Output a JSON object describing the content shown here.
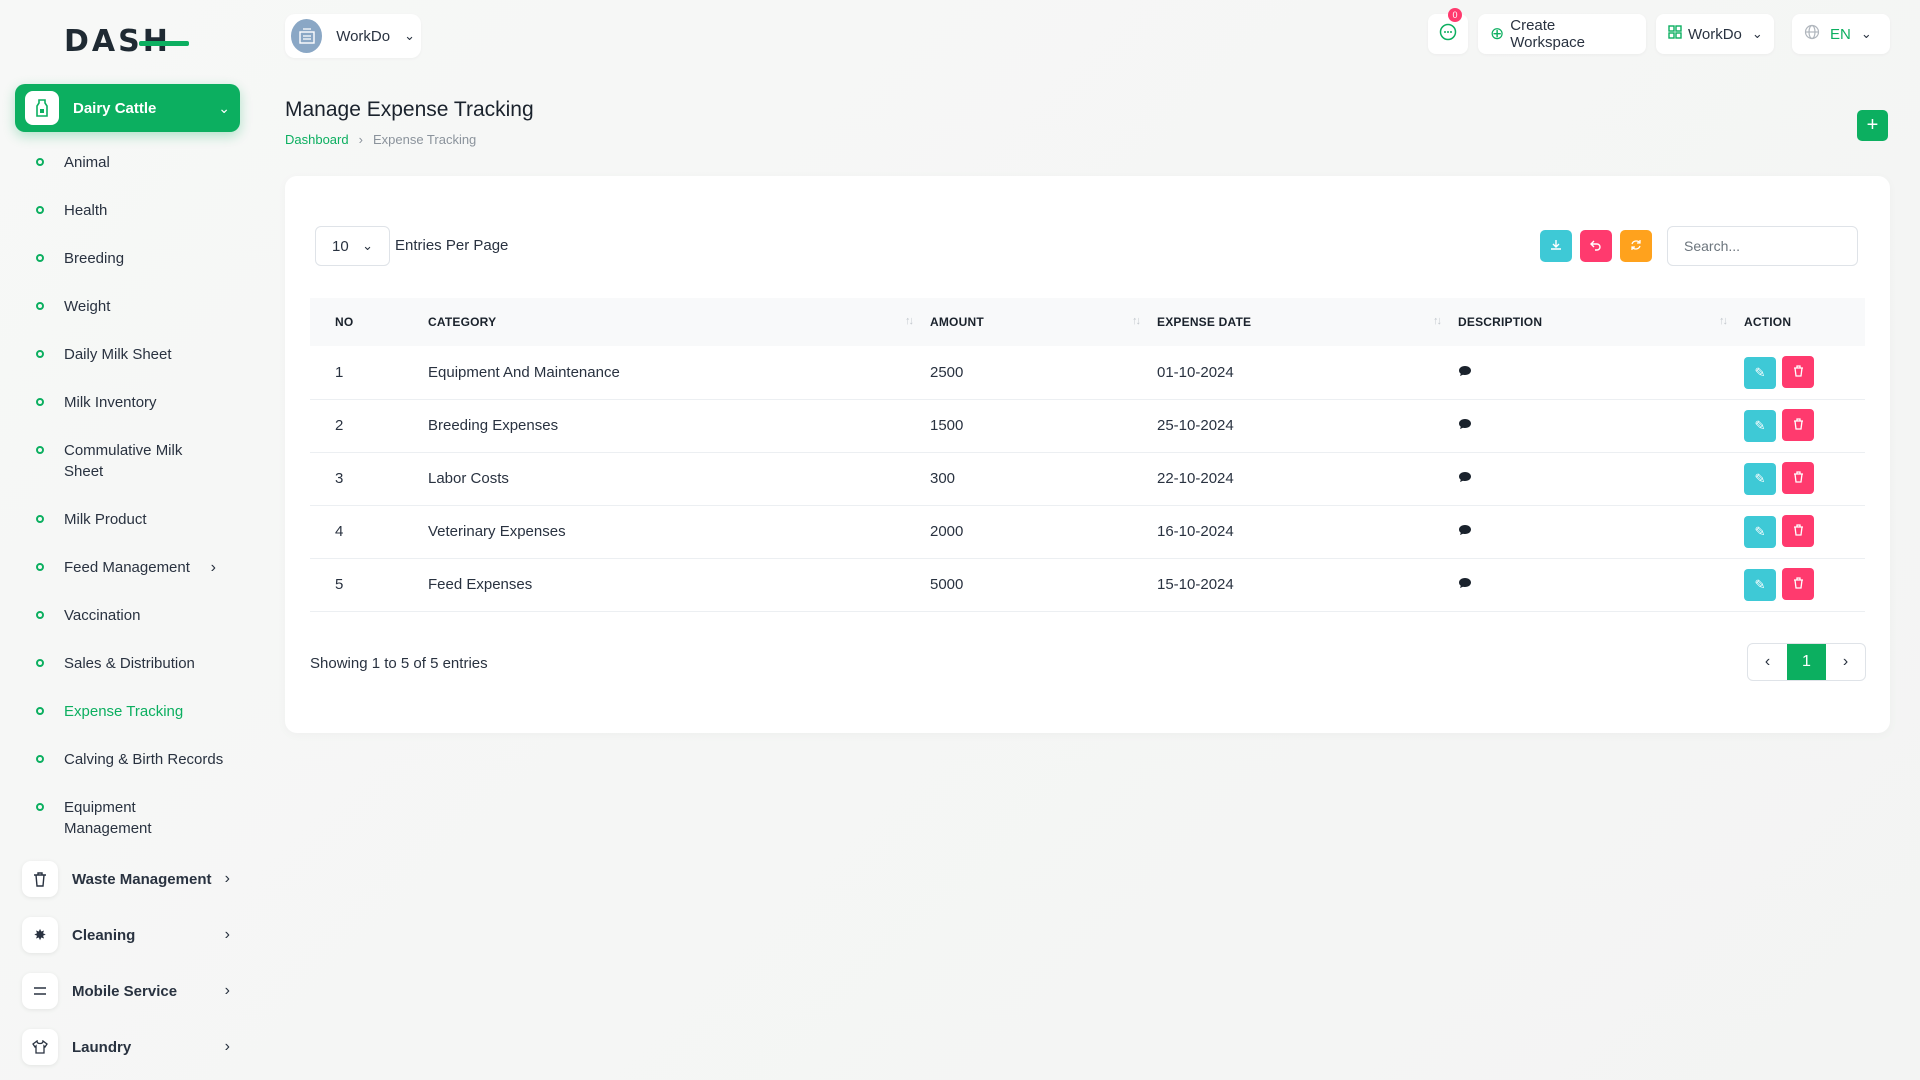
{
  "brand": {
    "logo_text": "DASH"
  },
  "sidebar": {
    "active_module": "Dairy Cattle",
    "items": [
      {
        "label": "Animal"
      },
      {
        "label": "Health"
      },
      {
        "label": "Breeding"
      },
      {
        "label": "Weight"
      },
      {
        "label": "Daily Milk Sheet"
      },
      {
        "label": "Milk Inventory"
      },
      {
        "label": "Commulative Milk Sheet"
      },
      {
        "label": "Milk Product"
      },
      {
        "label": "Feed Management"
      },
      {
        "label": "Vaccination"
      },
      {
        "label": "Sales & Distribution"
      },
      {
        "label": "Expense Tracking"
      },
      {
        "label": "Calving & Birth Records"
      },
      {
        "label": "Equipment Management"
      }
    ],
    "modules": [
      {
        "label": "Waste Management",
        "icon": "trash-icon"
      },
      {
        "label": "Cleaning",
        "icon": "sparkle-icon"
      },
      {
        "label": "Mobile Service",
        "icon": "menu-lines-icon"
      },
      {
        "label": "Laundry",
        "icon": "shirt-icon"
      }
    ]
  },
  "header": {
    "workspace_name": "WorkDo",
    "notification_count": "0",
    "create_workspace_label": "Create Workspace",
    "workspace_menu_label": "WorkDo",
    "language": "EN"
  },
  "page": {
    "title": "Manage Expense Tracking",
    "breadcrumb": [
      "Dashboard",
      "Expense Tracking"
    ]
  },
  "table_controls": {
    "per_page_value": "10",
    "per_page_label": "Entries Per Page",
    "search_placeholder": "Search..."
  },
  "table": {
    "columns": [
      "NO",
      "CATEGORY",
      "AMOUNT",
      "EXPENSE DATE",
      "DESCRIPTION",
      "ACTION"
    ],
    "rows": [
      {
        "no": "1",
        "category": "Equipment And Maintenance",
        "amount": "2500",
        "date": "01-10-2024"
      },
      {
        "no": "2",
        "category": "Breeding Expenses",
        "amount": "1500",
        "date": "25-10-2024"
      },
      {
        "no": "3",
        "category": "Labor Costs",
        "amount": "300",
        "date": "22-10-2024"
      },
      {
        "no": "4",
        "category": "Veterinary Expenses",
        "amount": "2000",
        "date": "16-10-2024"
      },
      {
        "no": "5",
        "category": "Feed Expenses",
        "amount": "5000",
        "date": "15-10-2024"
      }
    ]
  },
  "footer": {
    "showing": "Showing 1 to 5 of 5 entries",
    "current_page": "1"
  },
  "colors": {
    "accent": "#0caf60",
    "edit": "#3ec9d6",
    "delete": "#ff3a6e",
    "download": "#3ec9d6",
    "reset": "#ff3a6e",
    "refresh": "#ffa21d"
  }
}
